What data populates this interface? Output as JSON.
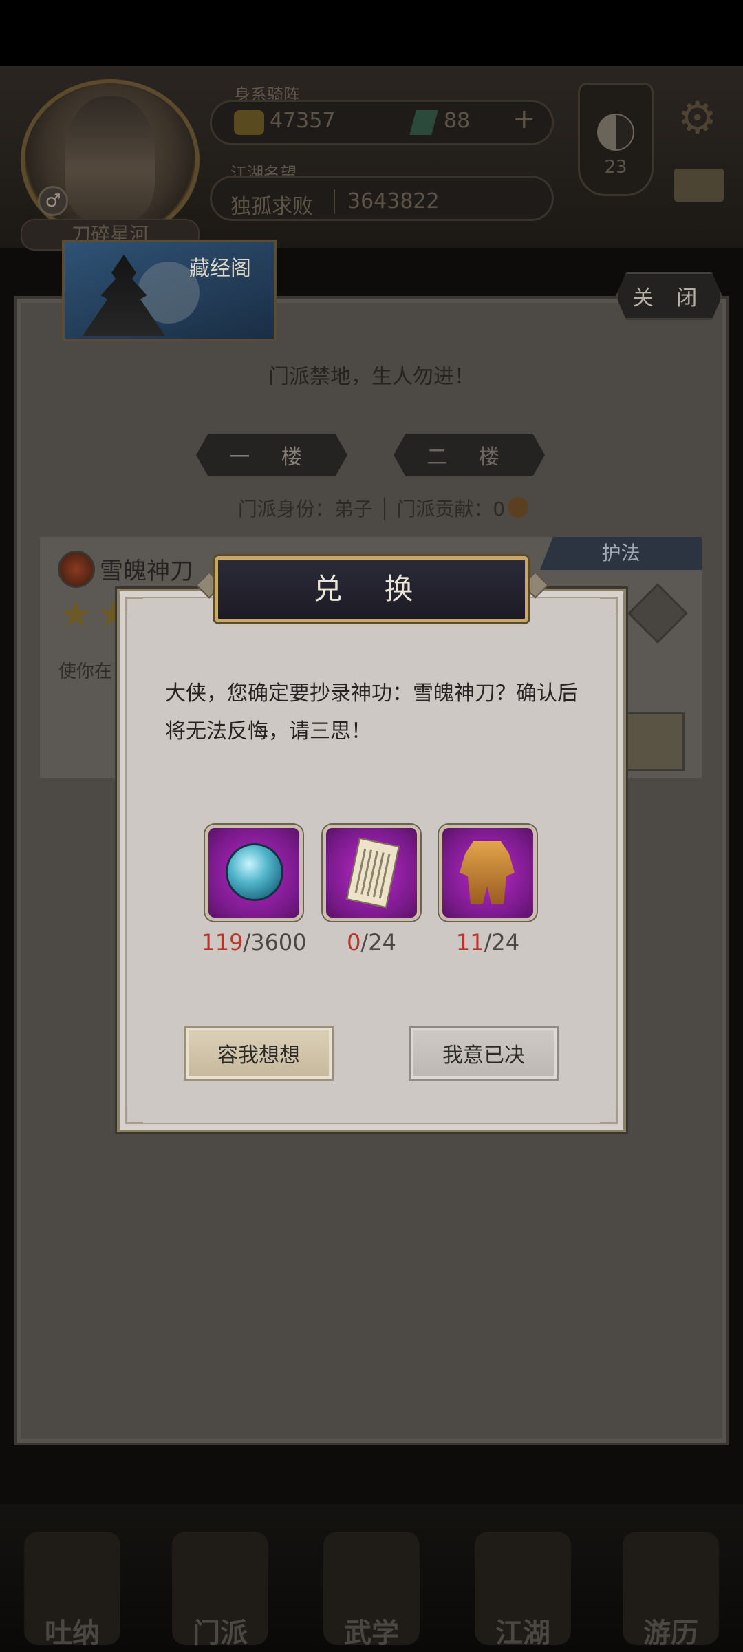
{
  "header": {
    "player_title": "身系骑阵",
    "gold": "47357",
    "jade": "88",
    "fame_label": "江湖名望",
    "fame_rank": "独孤求败",
    "fame_value": "3643822",
    "level": "23",
    "name": "刀碎星河"
  },
  "panel": {
    "pavilion_title": "藏经阁",
    "close_label": "关 闭",
    "forbidden_text": "门派禁地，生人勿进！",
    "floors": [
      "一 楼",
      "二 楼"
    ],
    "sect_status": "门派身份：弟子 │ 门派贡献：0",
    "skill": {
      "name": "雪魄神刀",
      "tag": "护法",
      "desc": "使你在"
    }
  },
  "dialog": {
    "title": "兑 换",
    "message": "大侠，您确定要抄录神功：雪魄神刀？确认后将无法反悔，请三思！",
    "materials": [
      {
        "icon": "jade-orb",
        "have": "119",
        "need": "/3600"
      },
      {
        "icon": "scroll",
        "have": "0",
        "need": "/24"
      },
      {
        "icon": "armor",
        "have": "11",
        "need": "/24"
      }
    ],
    "cancel_label": "容我想想",
    "confirm_label": "我意已决"
  },
  "nav": {
    "items": [
      "吐纳",
      "门派",
      "武学",
      "江湖",
      "游历"
    ]
  },
  "colors": {
    "dialog_bg": "#cdc8c4",
    "material_bg": "#b92ac6",
    "count_have": "#b5372c",
    "title_bg": "#1c1b25",
    "title_border": "#c6a869"
  }
}
